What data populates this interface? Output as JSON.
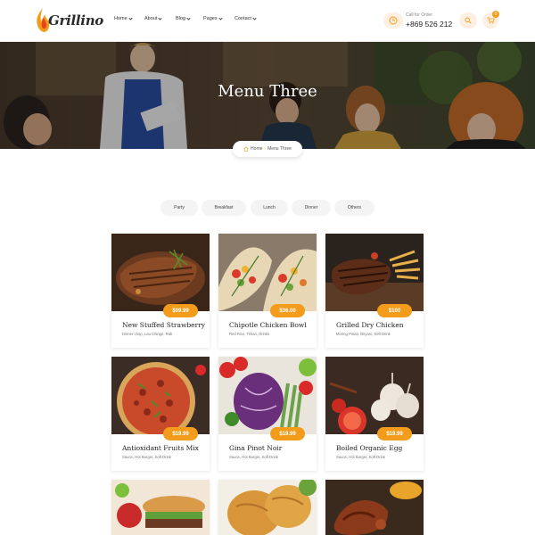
{
  "brand": {
    "name": "Grillino"
  },
  "nav": {
    "home": "Home",
    "about": "About",
    "blog": "Blog",
    "pages": "Pages",
    "contact": "Contact"
  },
  "contact": {
    "label": "Call for Order",
    "phone": "+869 526 212"
  },
  "cart": {
    "count": "0"
  },
  "hero": {
    "title": "Menu Three"
  },
  "breadcrumb": {
    "home": "Home",
    "current": "Menu Three"
  },
  "tabs": [
    "Party",
    "Breakfast",
    "Lunch",
    "Dinner",
    "Others"
  ],
  "menu": [
    {
      "title": "New Stuffed Strawberry",
      "desc": "Dinner chop, Lau Chingri, Rab",
      "price": "$99.99"
    },
    {
      "title": "Chipotle Chicken Bowl",
      "desc": "Red Rice, Tehari, Drinks",
      "price": "$36.00"
    },
    {
      "title": "Grilled Dry Chicken",
      "desc": "Moring Potao, Biryani, Soft Drink",
      "price": "$100"
    },
    {
      "title": "Antioxidant Fruits Mix",
      "desc": "Sauce, Hot Burger, Soft Drink",
      "price": "$19.99"
    },
    {
      "title": "Gina Pinot Noir",
      "desc": "Sauce, Hot Burger, Soft Drink",
      "price": "$19.99"
    },
    {
      "title": "Boiled Organic Egg",
      "desc": "Sauce, Hot Burger, Soft Drink",
      "price": "$19.99"
    }
  ],
  "colors": {
    "accent": "#f39c1b",
    "tab_bg": "#f4f4f4"
  },
  "icons": {
    "phone": "clock-phone-icon",
    "search": "search-icon",
    "cart": "cart-icon",
    "breadcrumb_home": "home-icon"
  }
}
